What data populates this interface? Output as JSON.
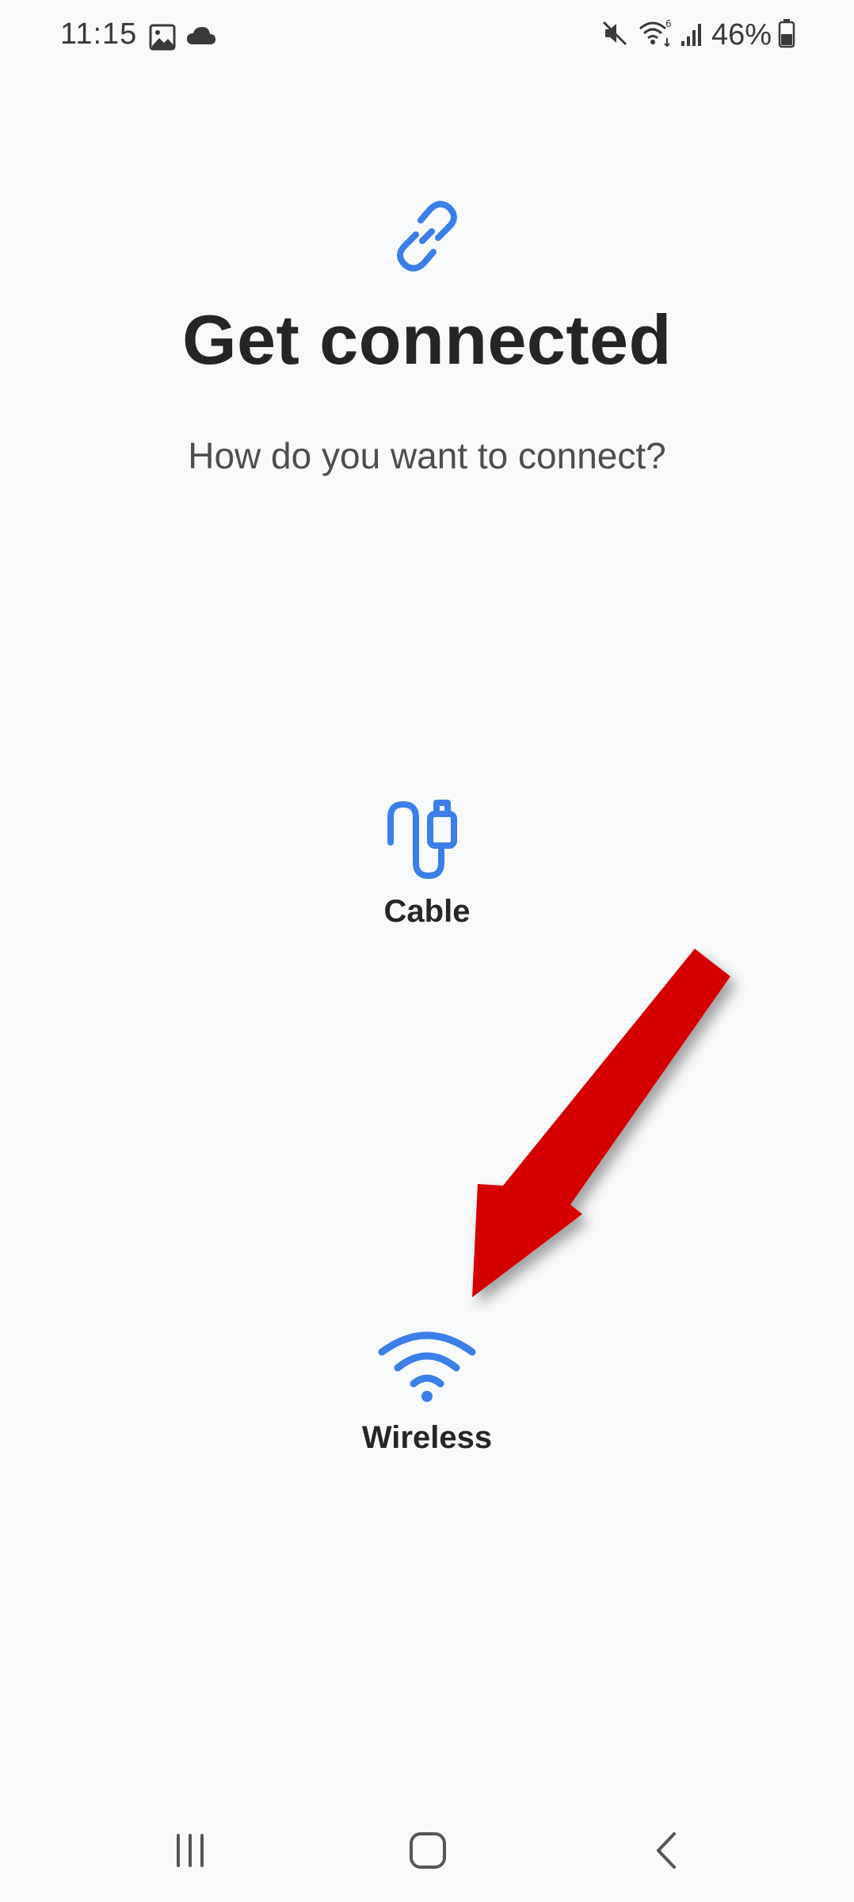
{
  "status_bar": {
    "time": "11:15",
    "battery_percent": "46%",
    "left_icons": [
      "gallery-icon",
      "cloud-icon"
    ],
    "right_icons": [
      "mute-icon",
      "wifi-6-icon",
      "signal-icon",
      "battery-icon"
    ]
  },
  "main": {
    "hero_icon": "link-icon",
    "title": "Get connected",
    "subtitle": "How do you want to connect?",
    "options": [
      {
        "label": "Cable",
        "icon": "cable-icon"
      },
      {
        "label": "Wireless",
        "icon": "wifi-icon"
      }
    ]
  },
  "annotation": {
    "icon": "red-arrow-annotation",
    "color": "#d40000"
  },
  "nav_bar": {
    "buttons": [
      "recents-icon",
      "home-icon",
      "back-icon"
    ]
  },
  "colors": {
    "accent": "#3b7ee8",
    "background": "#f8f9fb",
    "title": "#252525"
  }
}
